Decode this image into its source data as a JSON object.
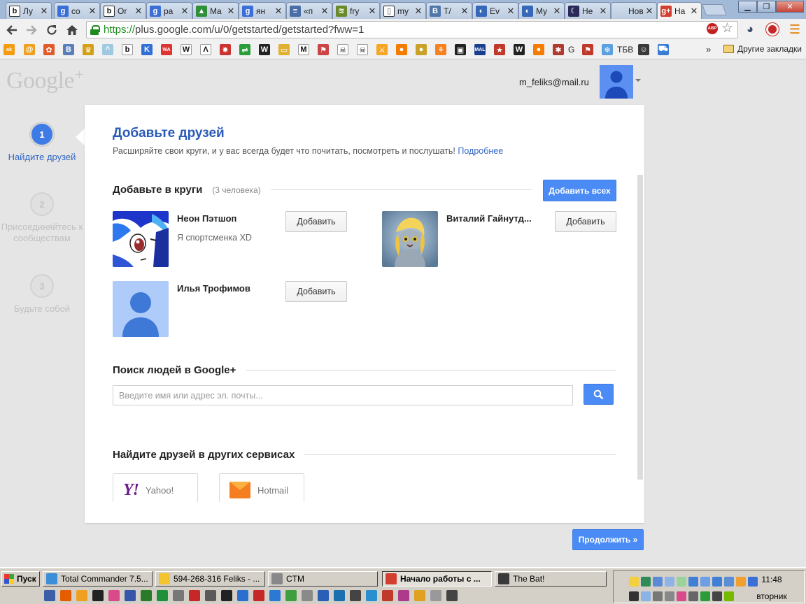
{
  "browser": {
    "tabs": [
      {
        "label": "Лу",
        "fav_text": "b",
        "fav_color": "#1a1a1a",
        "fav_bg": "#ffffff"
      },
      {
        "label": "co",
        "fav_text": "g",
        "fav_color": "#ffffff",
        "fav_bg": "#3b6fd8"
      },
      {
        "label": "Or",
        "fav_text": "b",
        "fav_color": "#1a1a1a",
        "fav_bg": "#ffffff"
      },
      {
        "label": "pa",
        "fav_text": "g",
        "fav_color": "#ffffff",
        "fav_bg": "#3b6fd8"
      },
      {
        "label": "Ma",
        "fav_text": "▲",
        "fav_color": "#ffffff",
        "fav_bg": "#2f8f3a"
      },
      {
        "label": "ян",
        "fav_text": "g",
        "fav_color": "#ffffff",
        "fav_bg": "#3b6fd8"
      },
      {
        "label": "«п",
        "fav_text": "≡",
        "fav_color": "#ffffff",
        "fav_bg": "#4a6fa8"
      },
      {
        "label": "fry",
        "fav_text": "≋",
        "fav_color": "#ffffff",
        "fav_bg": "#6a8a2a"
      },
      {
        "label": "my",
        "fav_text": "▯",
        "fav_color": "#555555",
        "fav_bg": "#ffffff"
      },
      {
        "label": "T/",
        "fav_text": "B",
        "fav_color": "#ffffff",
        "fav_bg": "#5077a8"
      },
      {
        "label": "Ev",
        "fav_text": "◐",
        "fav_color": "#ffffff",
        "fav_bg": "#3568b8"
      },
      {
        "label": "My",
        "fav_text": "◐",
        "fav_color": "#ffffff",
        "fav_bg": "#3568b8"
      },
      {
        "label": "He",
        "fav_text": "☾",
        "fav_color": "#ffffff",
        "fav_bg": "#2a2a5a"
      },
      {
        "label": "Новая",
        "fav_text": "",
        "fav_color": "#ffffff",
        "fav_bg": "transparent"
      },
      {
        "label": "На",
        "fav_text": "g+",
        "fav_color": "#ffffff",
        "fav_bg": "#d23f31"
      }
    ],
    "url_scheme": "https://",
    "url_rest": "plus.google.com/u/0/getstarted/getstarted?fww=1",
    "abp_label": "ABP",
    "bookmarks_more": "»",
    "bookmarks_folder": "Другие закладки",
    "bookmark_texts": {
      "g": "G",
      "tbv": "ТБВ"
    }
  },
  "page": {
    "logo": "Google",
    "logo_plus": "+",
    "user_email": "m_feliks@mail.ru",
    "steps": [
      {
        "num": "1",
        "label": "Найдите друзей"
      },
      {
        "num": "2",
        "label": "Присоединяйтесь к сообществам"
      },
      {
        "num": "3",
        "label": "Будьте собой"
      }
    ],
    "card": {
      "title": "Добавьте друзей",
      "subtitle": "Расширяйте свои круги, и у вас всегда будет что почитать, посмотреть и послушать!",
      "more_link": "Подробнее",
      "circles_title": "Добавьте в круги",
      "circles_count": "(3 человека)",
      "add_all": "Добавить всех",
      "add_label": "Добавить",
      "people": [
        {
          "name": "Неон Пэтшоп",
          "status": "Я спортсменка XD"
        },
        {
          "name": "Виталий Гайнутд...",
          "status": ""
        },
        {
          "name": "Илья Трофимов",
          "status": ""
        }
      ],
      "search_title": "Поиск людей в Google+",
      "search_placeholder": "Введите имя или адрес эл. почты...",
      "other_title": "Найдите друзей в других сервисах",
      "services": [
        {
          "logo": "Y!",
          "label": "Yahoo!"
        },
        {
          "logo": "",
          "label": "Hotmail"
        }
      ]
    },
    "continue": "Продолжить »"
  },
  "taskbar": {
    "start": "Пуск",
    "tasks": [
      {
        "label": "Total Commander 7.5...",
        "icon_color": "#3a8fd8"
      },
      {
        "label": "594-268-316 Feliks - ...",
        "icon_color": "#f4c430"
      },
      {
        "label": "CTM",
        "icon_color": "#888888"
      },
      {
        "label": "Начало работы с ...",
        "icon_color": "#d23f31"
      },
      {
        "label": "The Bat!",
        "icon_color": "#3a3a3a"
      }
    ],
    "clock": "11:48",
    "weekday": "вторник"
  }
}
